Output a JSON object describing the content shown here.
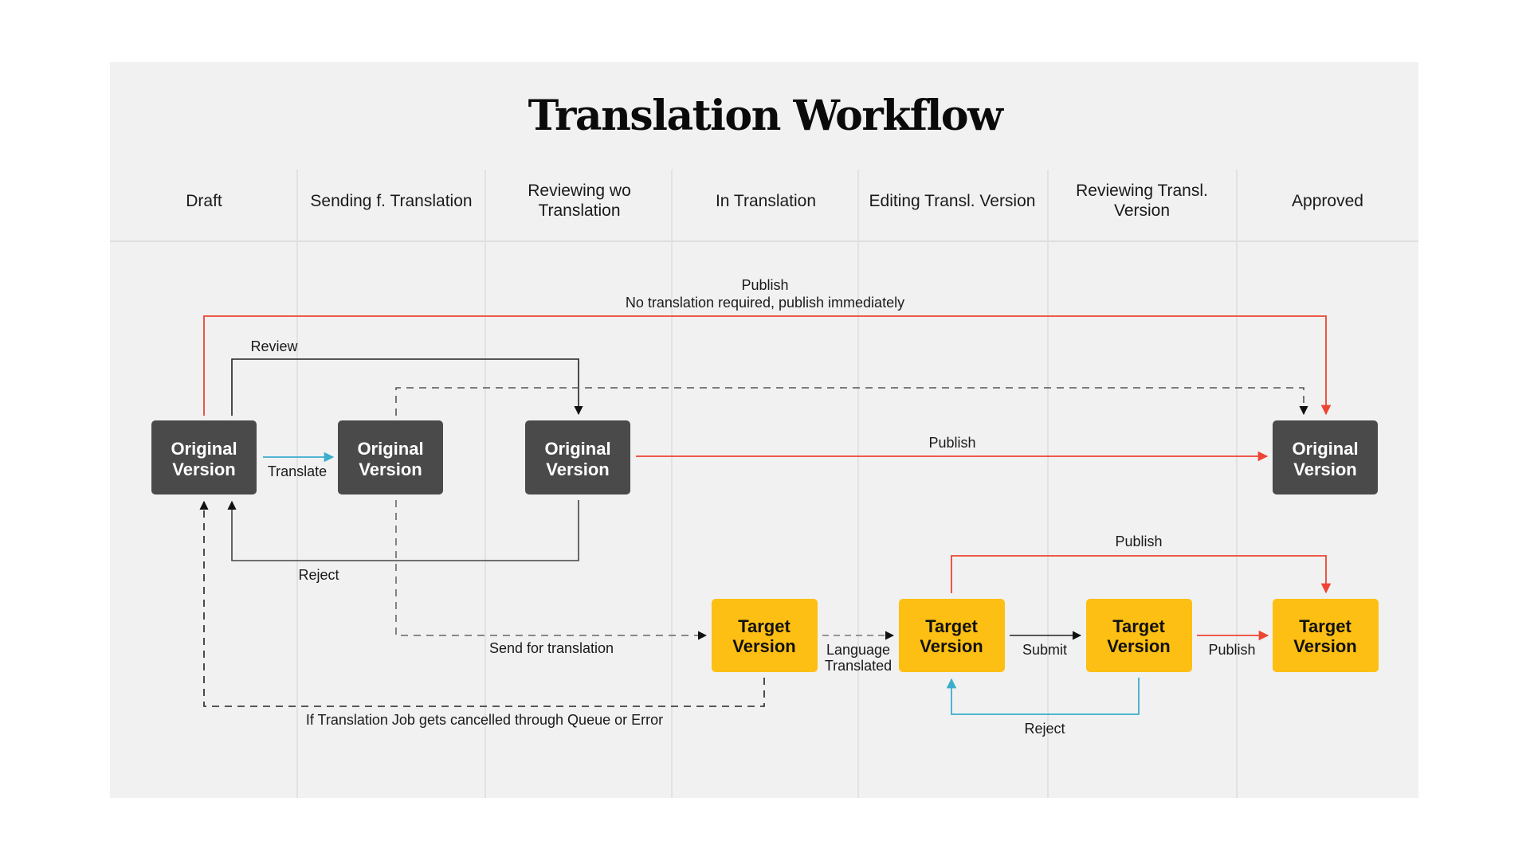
{
  "title": "Translation Workflow",
  "columns": [
    {
      "label": "Draft"
    },
    {
      "label": "Sending f. Translation"
    },
    {
      "label": "Reviewing wo Translation"
    },
    {
      "label": "In Translation"
    },
    {
      "label": "Editing Transl. Version"
    },
    {
      "label": "Reviewing Transl. Version"
    },
    {
      "label": "Approved"
    }
  ],
  "colors": {
    "panel_bg": "#f1f1f1",
    "original_box": "#4a4a4a",
    "target_box": "#fdbf13",
    "publish_red": "#ee4433",
    "translate_teal": "#3aaecb",
    "flow_black": "#1a1a1a",
    "dashed_gray": "#555555",
    "grid": "#dedede"
  },
  "nodes": {
    "original": [
      {
        "id": "orig-draft",
        "line1": "Original",
        "line2": "Version",
        "column": "Draft"
      },
      {
        "id": "orig-sending",
        "line1": "Original",
        "line2": "Version",
        "column": "Sending f. Translation"
      },
      {
        "id": "orig-reviewing",
        "line1": "Original",
        "line2": "Version",
        "column": "Reviewing wo Translation"
      },
      {
        "id": "orig-approved",
        "line1": "Original",
        "line2": "Version",
        "column": "Approved"
      }
    ],
    "target": [
      {
        "id": "target-in-translation",
        "line1": "Target",
        "line2": "Version",
        "column": "In Translation"
      },
      {
        "id": "target-editing",
        "line1": "Target",
        "line2": "Version",
        "column": "Editing Transl. Version"
      },
      {
        "id": "target-reviewing",
        "line1": "Target",
        "line2": "Version",
        "column": "Reviewing Transl. Version"
      },
      {
        "id": "target-approved",
        "line1": "Target",
        "line2": "Version",
        "column": "Approved"
      }
    ]
  },
  "edges": {
    "publish_immediately": {
      "line1": "Publish",
      "line2": "No translation required, publish immediately",
      "from": "orig-draft",
      "to": "orig-approved",
      "style": "red"
    },
    "review": {
      "label": "Review",
      "from": "orig-draft",
      "to": "orig-reviewing",
      "style": "black"
    },
    "translate": {
      "label": "Translate",
      "from": "orig-draft",
      "to": "orig-sending",
      "style": "teal"
    },
    "publish_original": {
      "label": "Publish",
      "from": "orig-reviewing",
      "to": "orig-approved",
      "style": "red"
    },
    "reject_original": {
      "label": "Reject",
      "from": "orig-reviewing",
      "to": "orig-draft",
      "style": "black"
    },
    "sending_to_approved": {
      "label": "",
      "from": "orig-sending",
      "to": "orig-approved",
      "style": "dashed"
    },
    "send_for_translation": {
      "label": "Send for translation",
      "from": "orig-sending",
      "to": "target-in-translation",
      "style": "dashed"
    },
    "cancelled": {
      "label": "If Translation Job gets cancelled through Queue or Error",
      "from": "target-in-translation",
      "to": "orig-draft",
      "style": "dashed"
    },
    "language_translated": {
      "line1": "Language",
      "line2": "Translated",
      "from": "target-in-translation",
      "to": "target-editing",
      "style": "dashed"
    },
    "submit": {
      "label": "Submit",
      "from": "target-editing",
      "to": "target-reviewing",
      "style": "black"
    },
    "publish_target": {
      "label": "Publish",
      "from": "target-reviewing",
      "to": "target-approved",
      "style": "red"
    },
    "publish_target_direct": {
      "label": "Publish",
      "from": "target-editing",
      "to": "target-approved",
      "style": "red"
    },
    "reject_target": {
      "label": "Reject",
      "from": "target-reviewing",
      "to": "target-editing",
      "style": "teal"
    }
  }
}
